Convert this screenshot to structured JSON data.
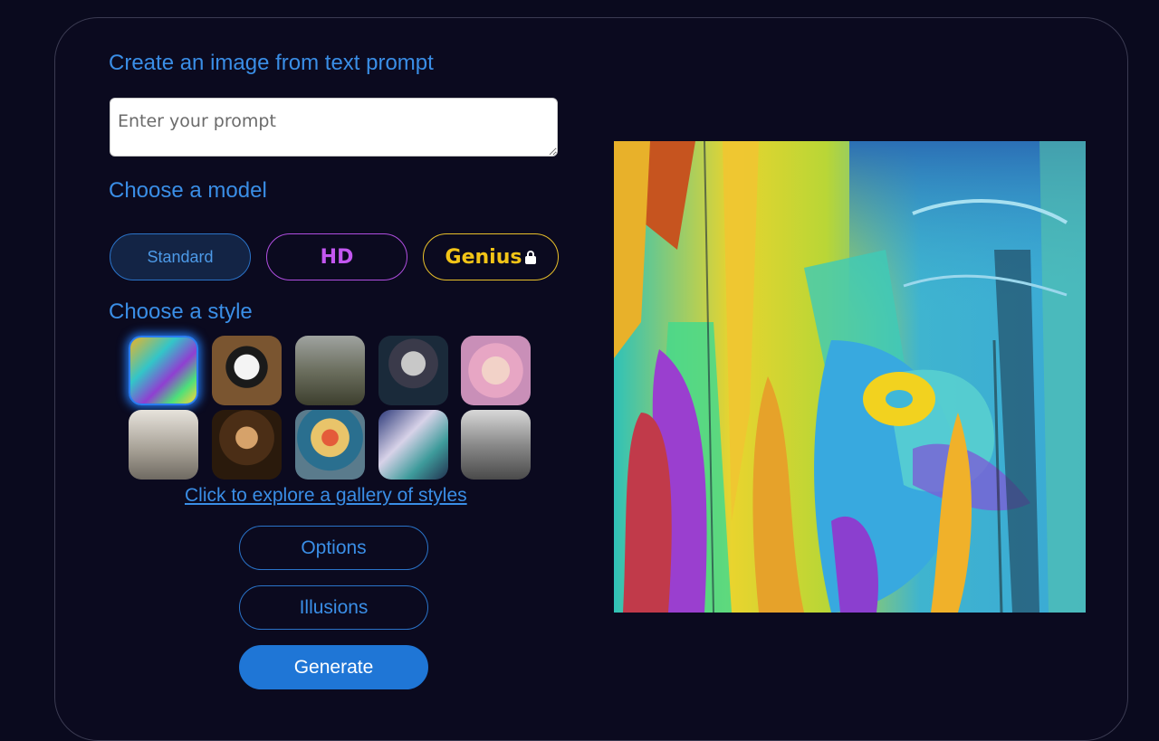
{
  "headings": {
    "create": "Create an image from text prompt",
    "model": "Choose a model",
    "style": "Choose a style"
  },
  "prompt": {
    "placeholder": "Enter your prompt",
    "value": ""
  },
  "models": {
    "standard": "Standard",
    "hd": "HD",
    "genius": "Genius"
  },
  "styles": {
    "selected_index": 0,
    "gallery_link": "Click to explore a gallery of styles"
  },
  "actions": {
    "options": "Options",
    "illusions": "Illusions",
    "generate": "Generate"
  },
  "colors": {
    "background": "#0a0a1e",
    "accent_blue": "#3a8ee6",
    "hd_purple": "#c357f0",
    "genius_gold": "#f2c417",
    "generate_blue": "#1f76d6"
  }
}
